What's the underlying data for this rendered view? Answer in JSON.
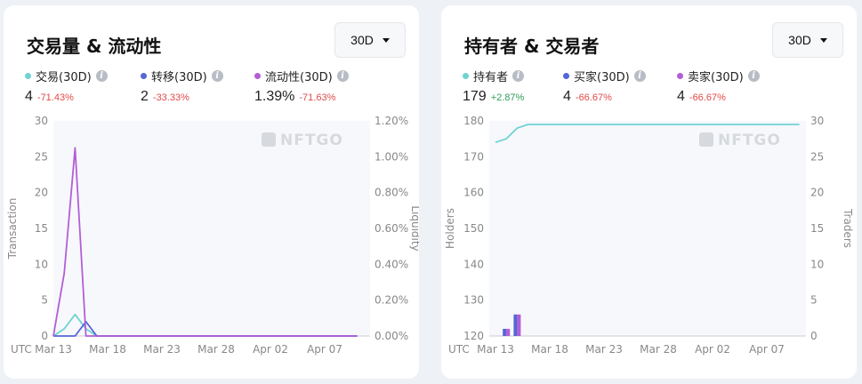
{
  "left_panel": {
    "title": "交易量 & 流动性",
    "range": "30D",
    "stats": [
      {
        "label": "交易(30D)",
        "value": "4",
        "change": "-71.43%",
        "color": "#6fd3d3",
        "trend": "neg"
      },
      {
        "label": "转移(30D)",
        "value": "2",
        "change": "-33.33%",
        "color": "#5566d6",
        "trend": "neg"
      },
      {
        "label": "流动性(30D)",
        "value": "1.39%",
        "change": "-71.63%",
        "color": "#b35ed6",
        "trend": "neg"
      }
    ],
    "watermark": "NFTGO"
  },
  "right_panel": {
    "title": "持有者 & 交易者",
    "range": "30D",
    "stats": [
      {
        "label": "持有者",
        "value": "179",
        "change": "+2.87%",
        "color": "#6fd3d3",
        "trend": "pos"
      },
      {
        "label": "买家(30D)",
        "value": "4",
        "change": "-66.67%",
        "color": "#5566d6",
        "trend": "neg"
      },
      {
        "label": "卖家(30D)",
        "value": "4",
        "change": "-66.67%",
        "color": "#b35ed6",
        "trend": "neg"
      }
    ],
    "watermark": "NFTGO"
  },
  "chart_data": [
    {
      "type": "line",
      "x_tick_labels": [
        "UTC",
        "Mar 13",
        "Mar 18",
        "Mar 23",
        "Mar 28",
        "Apr 02",
        "Apr 07"
      ],
      "ylabel": "Transaction",
      "y2label": "Liquidity",
      "ylim": [
        0,
        30
      ],
      "y_ticks": [
        "0",
        "5",
        "10",
        "15",
        "20",
        "25",
        "30"
      ],
      "y2lim": [
        0,
        1.2
      ],
      "y2_ticks": [
        "0.00%",
        "0.20%",
        "0.40%",
        "0.60%",
        "0.80%",
        "1.00%",
        "1.20%"
      ],
      "series": [
        {
          "axis": "left",
          "color": "#6fd3d3",
          "x": [
            "Mar 13",
            "Mar 14",
            "Mar 15",
            "Mar 16",
            "Mar 17",
            "Apr 10"
          ],
          "values": [
            0,
            1,
            3,
            1,
            0,
            0
          ]
        },
        {
          "axis": "left",
          "color": "#5566d6",
          "x": [
            "Mar 13",
            "Mar 14",
            "Mar 15",
            "Mar 16",
            "Mar 17",
            "Apr 10"
          ],
          "values": [
            0,
            0,
            0,
            2,
            0,
            0
          ]
        },
        {
          "axis": "right",
          "color": "#b35ed6",
          "x": [
            "Mar 13",
            "Mar 14",
            "Mar 15",
            "Mar 16",
            "Mar 17",
            "Apr 10"
          ],
          "values": [
            0,
            0.35,
            1.05,
            0,
            0,
            0
          ]
        }
      ]
    },
    {
      "type": "bar",
      "x_tick_labels": [
        "UTC",
        "Mar 13",
        "Mar 18",
        "Mar 23",
        "Mar 28",
        "Apr 02",
        "Apr 07"
      ],
      "ylabel": "Holders",
      "y2label": "Traders",
      "ylim": [
        120,
        180
      ],
      "y_ticks": [
        "120",
        "130",
        "140",
        "150",
        "160",
        "170",
        "180"
      ],
      "y2lim": [
        0,
        30
      ],
      "y2_ticks": [
        "0",
        "5",
        "10",
        "15",
        "20",
        "25",
        "30"
      ],
      "series": [
        {
          "type": "line",
          "axis": "left",
          "color": "#6fd3d3",
          "x": [
            "Mar 13",
            "Mar 14",
            "Mar 15",
            "Mar 16",
            "Apr 10"
          ],
          "values": [
            174,
            175,
            178,
            179,
            179
          ]
        },
        {
          "type": "bar",
          "axis": "right",
          "color": "#5566d6",
          "x": [
            "Mar 14",
            "Mar 15"
          ],
          "values": [
            1,
            3
          ]
        },
        {
          "type": "bar",
          "axis": "right",
          "color": "#b35ed6",
          "x": [
            "Mar 14",
            "Mar 15"
          ],
          "values": [
            1,
            3
          ]
        }
      ]
    }
  ]
}
